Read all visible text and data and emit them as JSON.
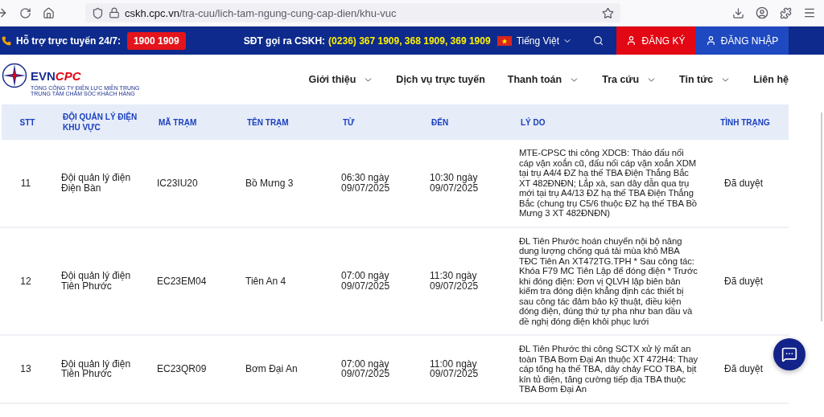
{
  "browser": {
    "url_host": "cskh.cpc.vn",
    "url_path": "/tra-cuu/lich-tam-ngung-cung-cap-dien/khu-vuc"
  },
  "top_bar": {
    "support_label": "Hỗ trợ trực tuyến 24/7:",
    "hotline": "1900 1909",
    "call_label": "SĐT gọi ra CSKH:",
    "call_numbers": "(0236) 367 1909, 368 1909, 369 1909",
    "language": "Tiếng Việt",
    "register": "ĐĂNG KÝ",
    "login": "ĐĂNG NHẬP"
  },
  "logo": {
    "brand_a": "EVN",
    "brand_b": "CPC",
    "line_1": "TỔNG CÔNG TY ĐIỆN LỰC MIỀN TRUNG",
    "line_2": "TRUNG TÂM CHĂM SÓC KHÁCH HÀNG"
  },
  "nav": [
    {
      "label": "Giới thiệu",
      "dropdown": true
    },
    {
      "label": "Dịch vụ trực tuyến",
      "dropdown": false
    },
    {
      "label": "Thanh toán",
      "dropdown": true
    },
    {
      "label": "Tra cứu",
      "dropdown": true
    },
    {
      "label": "Tin tức",
      "dropdown": true
    },
    {
      "label": "Liên hệ",
      "dropdown": false
    }
  ],
  "table": {
    "columns": [
      "STT",
      "ĐỘI QUẢN LÝ ĐIỆN KHU VỰC",
      "MÃ TRẠM",
      "TÊN TRẠM",
      "TỪ",
      "ĐẾN",
      "LÝ DO",
      "TÌNH TRẠNG"
    ],
    "rows": [
      {
        "stt": "11",
        "team": "Đội quản lý điện Điện Bàn",
        "code": "IC23IU20",
        "station": "Bồ Mưng 3",
        "from": "06:30 ngày 09/07/2025",
        "to": "10:30 ngày 09/07/2025",
        "reason": "MTE-CPSC thi công XDCB: Tháo đấu nối cáp vặn xoắn cũ, đấu nối cáp vặn xoắn XDM tại trụ A4/4 ĐZ hạ thế TBA Điện Thắng Bắc XT 482ĐNĐN; Lắp xà, san dây dẫn qua trụ mới tại trụ A4/13 ĐZ hạ thế TBA Điện Thắng Bắc (chung trụ C5/6 thuộc ĐZ hạ thế TBA Bồ Mưng 3 XT 482ĐNĐN)",
        "status": "Đã duyệt"
      },
      {
        "stt": "12",
        "team": "Đội quản lý điện Tiên Phước",
        "code": "EC23EM04",
        "station": "Tiên An 4",
        "from": "07:00 ngày 09/07/2025",
        "to": "11:30 ngày 09/07/2025",
        "reason": "ĐL Tiên Phước hoán chuyển nội bộ nâng dung lượng chống quá tải mùa khô MBA TĐC Tiên An XT472TG.TPH * Sau công tác: Khóa F79 MC Tiên Lập để đóng điện * Trước khi đóng điện: Đơn vị QLVH lập biên bản kiểm tra đóng điện khẳng định các thiết bị sau công tác đảm bảo kỹ thuật, điều kiện đóng điện, đúng thứ tự pha như ban đầu và đề nghị đóng điện khôi phục lưới",
        "status": "Đã duyệt"
      },
      {
        "stt": "13",
        "team": "Đội quản lý điện Tiên Phước",
        "code": "EC23QR09",
        "station": "Bơm Đại An",
        "from": "07:00 ngày 09/07/2025",
        "to": "11:00 ngày 09/07/2025",
        "reason": "ĐL Tiên Phước thi công SCTX xử lý mất an toàn TBA Bơm Đại An thuộc XT 472H4: Thay cáp tổng hạ thế TBA, dây chảy FCO TBA, bịt kín tủ điện, tăng cường tiếp địa TBA thuộc TBA Bơm Đại An",
        "status": "Đã duyệt"
      }
    ]
  }
}
